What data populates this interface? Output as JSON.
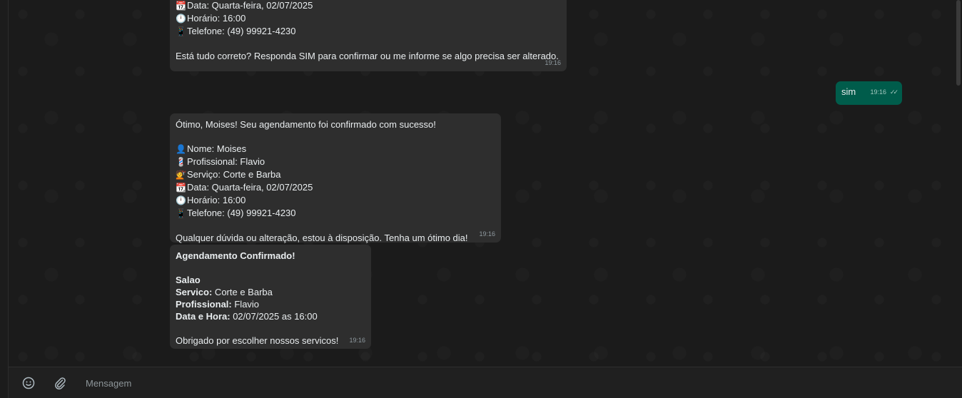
{
  "messages": {
    "m1": {
      "lines": [
        {
          "icon": "📆",
          "icon_name": "calendar-icon",
          "text": "Data: Quarta-feira, 02/07/2025"
        },
        {
          "icon": "🕛",
          "icon_name": "clock-icon",
          "text": "Horário: 16:00"
        },
        {
          "icon": "📱",
          "icon_name": "phone-icon",
          "text": "Telefone: (49) 99921-4230"
        },
        {
          "icon": "",
          "icon_name": "",
          "text": ""
        },
        {
          "icon": "",
          "icon_name": "",
          "text": "Está tudo correto? Responda SIM para confirmar ou me informe se algo precisa ser alterado."
        }
      ],
      "time": "19:16"
    },
    "m2": {
      "text": "sim",
      "time": "19:16",
      "status": "read"
    },
    "m3": {
      "lines": [
        {
          "icon": "",
          "icon_name": "",
          "text": "Ótimo, Moises! Seu agendamento foi confirmado com sucesso!"
        },
        {
          "icon": "",
          "icon_name": "",
          "text": ""
        },
        {
          "icon": "👤",
          "icon_name": "person-icon",
          "text": "Nome: Moises"
        },
        {
          "icon": "💈",
          "icon_name": "barber-pole-icon",
          "text": "Profissional: Flavio"
        },
        {
          "icon": "💇",
          "icon_name": "haircut-icon",
          "text": "Serviço: Corte e Barba"
        },
        {
          "icon": "📆",
          "icon_name": "calendar-icon",
          "text": "Data: Quarta-feira, 02/07/2025"
        },
        {
          "icon": "🕛",
          "icon_name": "clock-icon",
          "text": "Horário: 16:00"
        },
        {
          "icon": "📱",
          "icon_name": "phone-icon",
          "text": "Telefone: (49) 99921-4230"
        },
        {
          "icon": "",
          "icon_name": "",
          "text": ""
        },
        {
          "icon": "",
          "icon_name": "",
          "text": "Qualquer dúvida ou alteração, estou à disposição. Tenha um ótimo dia!"
        }
      ],
      "time": "19:16"
    },
    "m4": {
      "title": "Agendamento Confirmado!",
      "place": "Salao",
      "service_label": "Servico:",
      "service_value": " Corte e Barba",
      "pro_label": "Profissional:",
      "pro_value": " Flavio",
      "dt_label": "Data e Hora:",
      "dt_value": " 02/07/2025 as 16:00",
      "footer": "Obrigado por escolher nossos servicos!",
      "time": "19:16"
    }
  },
  "composer": {
    "placeholder": "Mensagem",
    "emoji_icon": "emoji-icon",
    "attach_icon": "paperclip-icon"
  },
  "colors": {
    "incoming_bubble": "#2e2e2e",
    "outgoing_bubble": "#005c4b",
    "background": "#1b1b1b"
  }
}
